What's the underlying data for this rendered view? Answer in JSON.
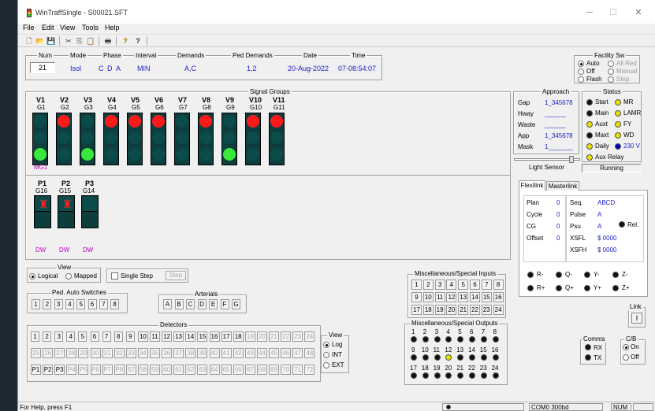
{
  "window": {
    "title": "WinTraffSingle - S00021.SFT",
    "minimize": "─",
    "maximize": "☐",
    "close": "✕"
  },
  "menu": [
    "File",
    "Edit",
    "View",
    "Tools",
    "Help"
  ],
  "toolbar": {
    "icons": [
      "new-icon",
      "open-icon",
      "save-icon",
      "cut-icon",
      "copy-icon",
      "paste-icon",
      "print-icon",
      "help-icon",
      "context-help-icon"
    ],
    "glyphs": [
      "🗋",
      "📂",
      "💾",
      "✂",
      "⎘",
      "📋",
      "🖶",
      "?",
      "?"
    ]
  },
  "info": {
    "headers": {
      "num": "Num",
      "mode": "Mode",
      "phase": "Phase",
      "interval": "Interval",
      "demands": "Demands",
      "ped_demands": "Ped Demands",
      "date": "Date",
      "time": "Time"
    },
    "values": {
      "num": "21",
      "mode": "Isol",
      "phase": [
        "C",
        "D",
        "A"
      ],
      "interval": "MIN",
      "demands": "A,C",
      "ped_demands": "1,2",
      "date": "20-Aug-2022",
      "time": "07-08:54:07"
    }
  },
  "facility": {
    "title": "Facility Sw",
    "options": [
      "Auto",
      "All Red",
      "Off",
      "Manual",
      "Flash",
      "Step"
    ],
    "selected": "Auto"
  },
  "signal_groups": {
    "title": "Signal Groups",
    "vehicle": [
      {
        "name": "V1",
        "group": "G1",
        "state": "green"
      },
      {
        "name": "V2",
        "group": "G2",
        "state": "red"
      },
      {
        "name": "V3",
        "group": "G3",
        "state": "green"
      },
      {
        "name": "V4",
        "group": "G4",
        "state": "red"
      },
      {
        "name": "V5",
        "group": "G5",
        "state": "red"
      },
      {
        "name": "V6",
        "group": "G6",
        "state": "red"
      },
      {
        "name": "V7",
        "group": "G7",
        "state": "off"
      },
      {
        "name": "V8",
        "group": "G8",
        "state": "red"
      },
      {
        "name": "V9",
        "group": "G9",
        "state": "green"
      },
      {
        "name": "V10",
        "group": "G10",
        "state": "red"
      },
      {
        "name": "V11",
        "group": "G11",
        "state": "red"
      }
    ],
    "vehicle_note": "MG1",
    "pedestrian": [
      {
        "name": "P1",
        "group": "G16",
        "state": "red",
        "label": "DW"
      },
      {
        "name": "P2",
        "group": "G15",
        "state": "red",
        "label": "DW"
      },
      {
        "name": "P3",
        "group": "G14",
        "state": "off",
        "label": "DW"
      }
    ]
  },
  "approach": {
    "title": "Approach",
    "rows": [
      {
        "label": "Gap",
        "value": "1_345678"
      },
      {
        "label": "Hway",
        "value": "______"
      },
      {
        "label": "Waste",
        "value": "______"
      },
      {
        "label": "App",
        "value": "1_345678"
      },
      {
        "label": "Mask",
        "value": "1_______"
      }
    ]
  },
  "status_panel": {
    "title": "Status",
    "items": [
      {
        "label": "Start",
        "lamp": "black"
      },
      {
        "label": "MR",
        "lamp": "yellow"
      },
      {
        "label": "Main",
        "lamp": "black"
      },
      {
        "label": "LAMR",
        "lamp": "yellow"
      },
      {
        "label": "Auxt",
        "lamp": "yellow"
      },
      {
        "label": "FY",
        "lamp": "yellow"
      },
      {
        "label": "Maxt",
        "lamp": "black"
      },
      {
        "label": "WD",
        "lamp": "yellow"
      },
      {
        "label": "Daily",
        "lamp": "yellow"
      },
      {
        "label": "230 V",
        "lamp": "blue"
      }
    ],
    "aux_relay": "Aux Relay",
    "running": "Running"
  },
  "light_sensor": {
    "label": "Light Sensor",
    "level": 0.9
  },
  "flexilink": {
    "tabs": [
      "Flexilink",
      "Masterlink"
    ],
    "active": "Flexilink",
    "left": [
      {
        "label": "Plan",
        "value": "0"
      },
      {
        "label": "Cycle",
        "value": "0"
      },
      {
        "label": "CG",
        "value": "0"
      },
      {
        "label": "Offset",
        "value": "0"
      }
    ],
    "right": [
      {
        "label": "Seq.",
        "value": "ABCD"
      },
      {
        "label": "Pulse",
        "value": "A"
      },
      {
        "label": "Psu",
        "value": "A"
      },
      {
        "label": "XSFL",
        "value": "$ 0000"
      },
      {
        "label": "XSFH",
        "value": "$ 0000"
      }
    ],
    "rel": "Rel.",
    "lamps_row1": [
      "R-",
      "Q-",
      "Y-",
      "Z-"
    ],
    "lamps_row2": [
      "R+",
      "Q+",
      "Y+",
      "Z+"
    ]
  },
  "view_mode": {
    "title": "View",
    "options": [
      "Logical",
      "Mapped"
    ],
    "selected": "Logical"
  },
  "single_step": {
    "label": "Single Step",
    "button": "Step"
  },
  "ped_auto": {
    "title": "Ped. Auto Switches",
    "buttons": [
      "1",
      "2",
      "3",
      "4",
      "5",
      "6",
      "7",
      "8"
    ]
  },
  "arterials": {
    "title": "Arterials",
    "buttons": [
      "A",
      "B",
      "C",
      "D",
      "E",
      "F",
      "G"
    ]
  },
  "detectors": {
    "title": "Detectors",
    "row1": [
      "1",
      "2",
      "3",
      "4",
      "5",
      "6",
      "7",
      "8",
      "9",
      "10",
      "11",
      "12",
      "13",
      "14",
      "15",
      "16",
      "17",
      "18",
      "19",
      "20",
      "21",
      "22",
      "23",
      "24"
    ],
    "row1_enabled": 18,
    "row2": [
      "25",
      "26",
      "27",
      "28",
      "29",
      "30",
      "31",
      "32",
      "33",
      "34",
      "35",
      "36",
      "37",
      "38",
      "39",
      "40",
      "41",
      "42",
      "43",
      "44",
      "45",
      "46",
      "47",
      "48"
    ],
    "row3": [
      "P1",
      "P2",
      "P3",
      "P4",
      "P5",
      "P6",
      "P7",
      "P8",
      "57",
      "58",
      "59",
      "60",
      "61",
      "62",
      "63",
      "64",
      "65",
      "66",
      "67",
      "68",
      "69",
      "70",
      "71",
      "72"
    ],
    "row3_enabled": 3
  },
  "det_view": {
    "title": "View",
    "options": [
      "Log",
      "INT",
      "EXT"
    ],
    "selected": "Log"
  },
  "misc_inputs": {
    "title": "Miscellaneous/Special Inputs",
    "buttons": [
      "1",
      "2",
      "3",
      "4",
      "5",
      "6",
      "7",
      "8",
      "9",
      "10",
      "11",
      "12",
      "13",
      "14",
      "15",
      "16",
      "17",
      "18",
      "19",
      "20",
      "21",
      "22",
      "23",
      "24"
    ]
  },
  "misc_outputs": {
    "title": "Miscellaneous/Special Outputs",
    "labels": [
      "1",
      "2",
      "3",
      "4",
      "5",
      "6",
      "7",
      "8",
      "9",
      "10",
      "11",
      "12",
      "13",
      "14",
      "15",
      "16",
      "17",
      "18",
      "19",
      "20",
      "21",
      "22",
      "23",
      "24"
    ],
    "yellow_index": 3
  },
  "link": {
    "title": "Link",
    "button": "I"
  },
  "comms": {
    "title": "Comms",
    "items": [
      "RX",
      "TX"
    ]
  },
  "cb": {
    "title": "C/B",
    "options": [
      "On",
      "Off"
    ],
    "selected": "On"
  },
  "statusbar": {
    "help": "For Help, press F1",
    "port": "COM0 300bd",
    "num": "NUM"
  }
}
